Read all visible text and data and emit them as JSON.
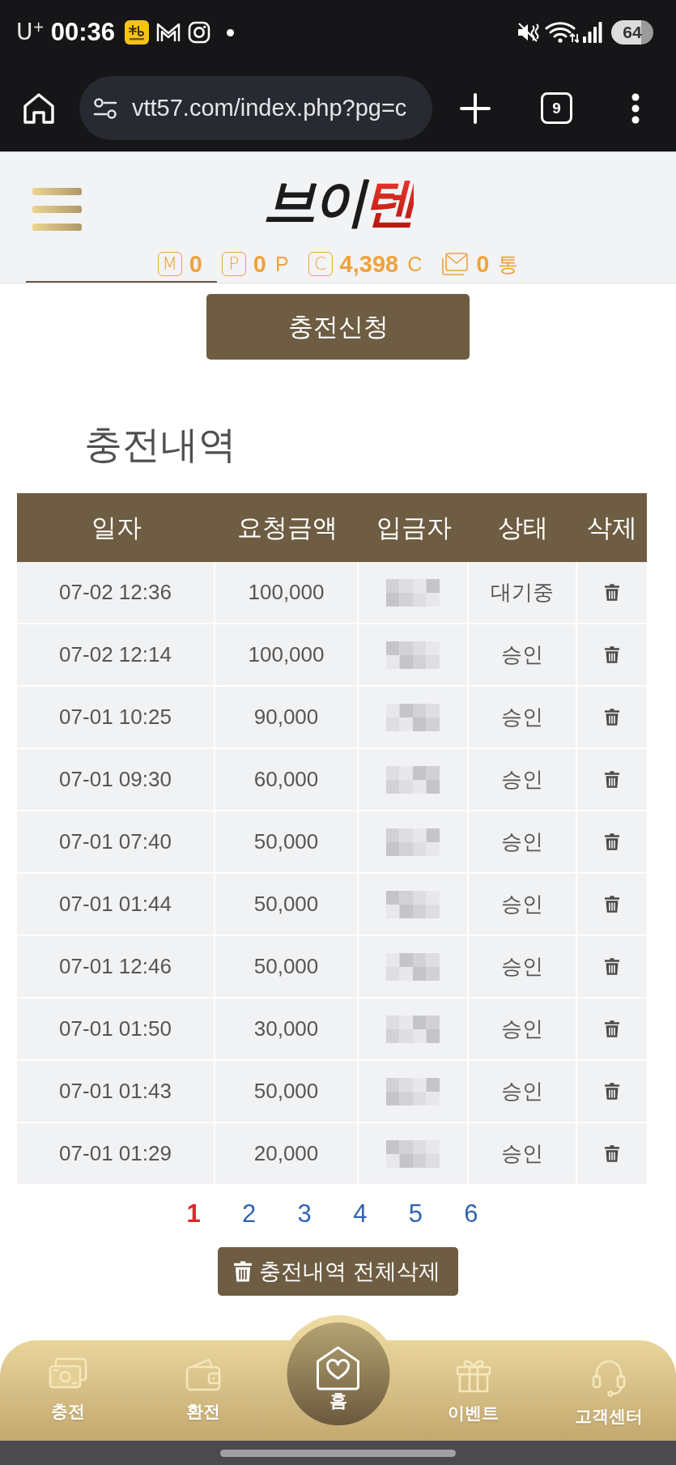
{
  "status_bar": {
    "carrier": "U$^{+}$",
    "time": "00:36",
    "battery": "64"
  },
  "browser": {
    "url": "vtt57.com/index.php?pg=c",
    "tab_count": "9"
  },
  "header": {
    "logo": {
      "main": "브이",
      "accent": "텐"
    },
    "balances": [
      {
        "kind": "letter",
        "symbol": "M",
        "value": "0"
      },
      {
        "kind": "letter",
        "symbol": "P",
        "value": "0",
        "unit": "P"
      },
      {
        "kind": "letter",
        "symbol": "C",
        "value": "4,398",
        "unit": "C"
      },
      {
        "kind": "mail",
        "value": "0",
        "unit": "통"
      }
    ]
  },
  "apply_button": "충전신청",
  "section_title": "충전내역",
  "table": {
    "columns": [
      "일자",
      "요청금액",
      "입금자",
      "상태",
      "삭제"
    ],
    "rows": [
      {
        "date": "07-02 12:36",
        "amount": "100,000",
        "status": "대기중"
      },
      {
        "date": "07-02 12:14",
        "amount": "100,000",
        "status": "승인"
      },
      {
        "date": "07-01 10:25",
        "amount": "90,000",
        "status": "승인"
      },
      {
        "date": "07-01 09:30",
        "amount": "60,000",
        "status": "승인"
      },
      {
        "date": "07-01 07:40",
        "amount": "50,000",
        "status": "승인"
      },
      {
        "date": "07-01 01:44",
        "amount": "50,000",
        "status": "승인"
      },
      {
        "date": "07-01 12:46",
        "amount": "50,000",
        "status": "승인"
      },
      {
        "date": "07-01 01:50",
        "amount": "30,000",
        "status": "승인"
      },
      {
        "date": "07-01 01:43",
        "amount": "50,000",
        "status": "승인"
      },
      {
        "date": "07-01 01:29",
        "amount": "20,000",
        "status": "승인"
      }
    ]
  },
  "pagination": [
    {
      "label": "1",
      "selected": true
    },
    {
      "label": "2",
      "selected": false
    },
    {
      "label": "3",
      "selected": false
    },
    {
      "label": "4",
      "selected": false
    },
    {
      "label": "5",
      "selected": false
    },
    {
      "label": "6",
      "selected": false
    }
  ],
  "delete_all_button": "충전내역 전체삭제",
  "bottom_nav": [
    {
      "kind": "cash",
      "label": "충전"
    },
    {
      "kind": "wallet",
      "label": "환전"
    },
    {
      "kind": "home",
      "label": "홈"
    },
    {
      "kind": "gift",
      "label": "이벤트"
    },
    {
      "kind": "headset",
      "label": "고객센터"
    }
  ]
}
